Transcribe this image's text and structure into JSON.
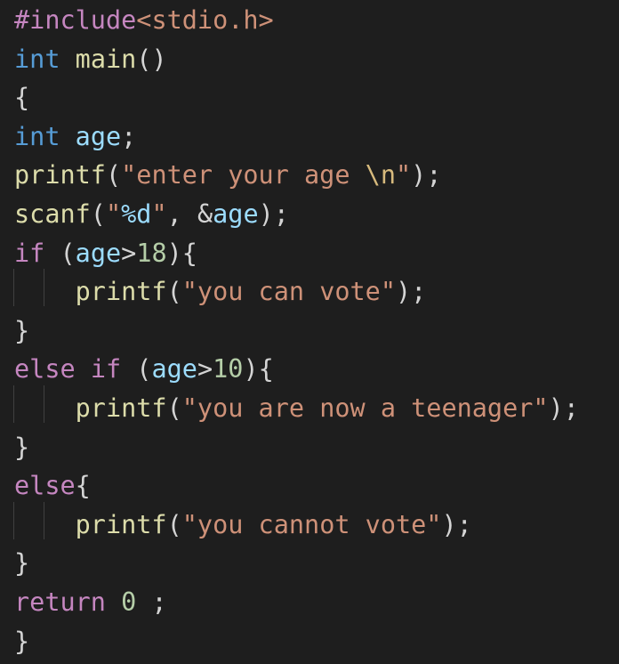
{
  "colors": {
    "background": "#1e1e1e",
    "keyword_control": "#c586c0",
    "keyword_type": "#569cd6",
    "function": "#dcdcaa",
    "variable": "#9cdcfe",
    "string": "#ce9178",
    "number": "#b5cea8",
    "escape": "#d7ba7d",
    "punctuation": "#d4d4d4",
    "indent_guide": "#404040"
  },
  "code_lines": [
    {
      "tokens": [
        {
          "text": "#include",
          "color": "#c586c0"
        },
        {
          "text": "<stdio.h>",
          "color": "#ce9178"
        }
      ]
    },
    {
      "tokens": [
        {
          "text": "int",
          "color": "#569cd6"
        },
        {
          "text": " ",
          "color": "#d4d4d4"
        },
        {
          "text": "main",
          "color": "#dcdcaa"
        },
        {
          "text": "()",
          "color": "#d4d4d4"
        }
      ]
    },
    {
      "tokens": [
        {
          "text": "{",
          "color": "#d4d4d4"
        }
      ]
    },
    {
      "tokens": [
        {
          "text": "int",
          "color": "#569cd6"
        },
        {
          "text": " ",
          "color": "#d4d4d4"
        },
        {
          "text": "age",
          "color": "#9cdcfe"
        },
        {
          "text": ";",
          "color": "#d4d4d4"
        }
      ]
    },
    {
      "tokens": [
        {
          "text": "printf",
          "color": "#dcdcaa"
        },
        {
          "text": "(",
          "color": "#d4d4d4"
        },
        {
          "text": "\"enter your age ",
          "color": "#ce9178"
        },
        {
          "text": "\\n",
          "color": "#d7ba7d"
        },
        {
          "text": "\"",
          "color": "#ce9178"
        },
        {
          "text": ");",
          "color": "#d4d4d4"
        }
      ]
    },
    {
      "tokens": [
        {
          "text": "scanf",
          "color": "#dcdcaa"
        },
        {
          "text": "(",
          "color": "#d4d4d4"
        },
        {
          "text": "\"",
          "color": "#ce9178"
        },
        {
          "text": "%d",
          "color": "#9cdcfe"
        },
        {
          "text": "\"",
          "color": "#ce9178"
        },
        {
          "text": ", &",
          "color": "#d4d4d4"
        },
        {
          "text": "age",
          "color": "#9cdcfe"
        },
        {
          "text": ");",
          "color": "#d4d4d4"
        }
      ]
    },
    {
      "tokens": [
        {
          "text": "if",
          "color": "#c586c0"
        },
        {
          "text": " (",
          "color": "#d4d4d4"
        },
        {
          "text": "age",
          "color": "#9cdcfe"
        },
        {
          "text": ">",
          "color": "#d4d4d4"
        },
        {
          "text": "18",
          "color": "#b5cea8"
        },
        {
          "text": "){",
          "color": "#d4d4d4"
        }
      ]
    },
    {
      "tokens": [
        {
          "text": "    ",
          "color": "#d4d4d4"
        },
        {
          "text": "printf",
          "color": "#dcdcaa"
        },
        {
          "text": "(",
          "color": "#d4d4d4"
        },
        {
          "text": "\"you can vote\"",
          "color": "#ce9178"
        },
        {
          "text": ");",
          "color": "#d4d4d4"
        }
      ]
    },
    {
      "tokens": [
        {
          "text": "}",
          "color": "#d4d4d4"
        }
      ]
    },
    {
      "tokens": [
        {
          "text": "else",
          "color": "#c586c0"
        },
        {
          "text": " ",
          "color": "#d4d4d4"
        },
        {
          "text": "if",
          "color": "#c586c0"
        },
        {
          "text": " (",
          "color": "#d4d4d4"
        },
        {
          "text": "age",
          "color": "#9cdcfe"
        },
        {
          "text": ">",
          "color": "#d4d4d4"
        },
        {
          "text": "10",
          "color": "#b5cea8"
        },
        {
          "text": "){",
          "color": "#d4d4d4"
        }
      ]
    },
    {
      "tokens": [
        {
          "text": "    ",
          "color": "#d4d4d4"
        },
        {
          "text": "printf",
          "color": "#dcdcaa"
        },
        {
          "text": "(",
          "color": "#d4d4d4"
        },
        {
          "text": "\"you are now a teenager\"",
          "color": "#ce9178"
        },
        {
          "text": ");",
          "color": "#d4d4d4"
        }
      ]
    },
    {
      "tokens": [
        {
          "text": "}",
          "color": "#d4d4d4"
        }
      ]
    },
    {
      "tokens": [
        {
          "text": "else",
          "color": "#c586c0"
        },
        {
          "text": "{",
          "color": "#d4d4d4"
        }
      ]
    },
    {
      "tokens": [
        {
          "text": "    ",
          "color": "#d4d4d4"
        },
        {
          "text": "printf",
          "color": "#dcdcaa"
        },
        {
          "text": "(",
          "color": "#d4d4d4"
        },
        {
          "text": "\"you cannot vote\"",
          "color": "#ce9178"
        },
        {
          "text": ");",
          "color": "#d4d4d4"
        }
      ]
    },
    {
      "tokens": [
        {
          "text": "}",
          "color": "#d4d4d4"
        }
      ]
    },
    {
      "tokens": [
        {
          "text": "return",
          "color": "#c586c0"
        },
        {
          "text": " ",
          "color": "#d4d4d4"
        },
        {
          "text": "0",
          "color": "#b5cea8"
        },
        {
          "text": " ;",
          "color": "#d4d4d4"
        }
      ]
    },
    {
      "tokens": [
        {
          "text": "}",
          "color": "#d4d4d4"
        }
      ]
    }
  ]
}
